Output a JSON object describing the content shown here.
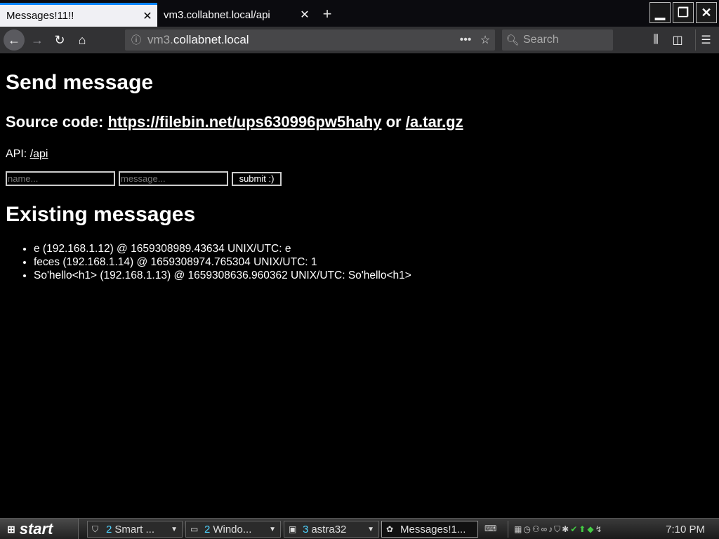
{
  "browser": {
    "tabs": [
      {
        "title": "Messages!11!!",
        "active": true
      },
      {
        "title": "vm3.collabnet.local/api",
        "active": false
      }
    ],
    "url_prefix": "vm3.",
    "url_domain": "collabnet.local",
    "search_placeholder": "Search",
    "accent_color": "#0a84ff"
  },
  "page": {
    "heading_send": "Send message",
    "source_label": "Source code: ",
    "source_link": "https://filebin.net/ups630996pw5hahy",
    "source_or": " or ",
    "source_link2": "/a.tar.gz",
    "api_label": "API: ",
    "api_link": "/api",
    "form": {
      "name_placeholder": "name...",
      "message_placeholder": "message...",
      "submit_label": "submit :)"
    },
    "heading_existing": "Existing messages",
    "messages": [
      "e (192.168.1.12) @ 1659308989.43634 UNIX/UTC: e",
      "feces (192.168.1.14) @ 1659308974.765304 UNIX/UTC: 1",
      "So'hello<h1> (192.168.1.13) @ 1659308636.960362 UNIX/UTC: So'hello<h1>"
    ]
  },
  "taskbar": {
    "start_label": "start",
    "groups": [
      {
        "count": "2",
        "label": "Smart ...",
        "icon": "shield-icon"
      },
      {
        "count": "2",
        "label": "Windo...",
        "icon": "folder-icon"
      },
      {
        "count": "3",
        "label": "astra32",
        "icon": "monitor-icon"
      },
      {
        "count": "",
        "label": "Messages!1...",
        "icon": "firefox-icon"
      }
    ],
    "clock": "7:10 PM"
  }
}
